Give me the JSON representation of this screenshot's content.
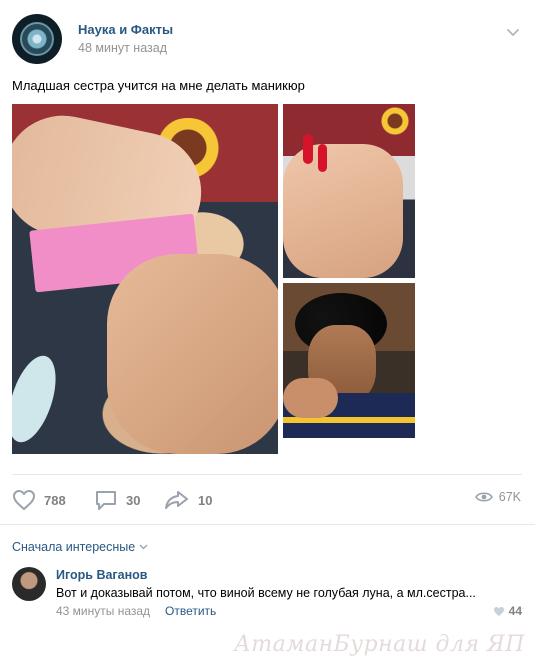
{
  "post": {
    "author": "Наука и Факты",
    "time": "48 минут назад",
    "text": "Младшая сестра учится на мне делать маникюр"
  },
  "photos": [
    {
      "id": "photo-1",
      "description_icon": "photo"
    },
    {
      "id": "photo-2",
      "description_icon": "photo"
    },
    {
      "id": "photo-3",
      "description_icon": "photo"
    }
  ],
  "actions": {
    "likes": "788",
    "comments": "30",
    "shares": "10",
    "views": "67K"
  },
  "comments_section": {
    "sort_label": "Сначала интересные",
    "items": [
      {
        "author": "Игорь Ваганов",
        "text": "Вот и доказывай потом, что виной всему не голубая луна, а мл.сестра...",
        "time": "43 минуты назад",
        "reply_label": "Ответить",
        "likes": "44"
      }
    ]
  },
  "watermark": "АтаманБурнаш для ЯП",
  "colors": {
    "link": "#2a5885",
    "muted": "#939393",
    "icon": "#99a2ad"
  }
}
